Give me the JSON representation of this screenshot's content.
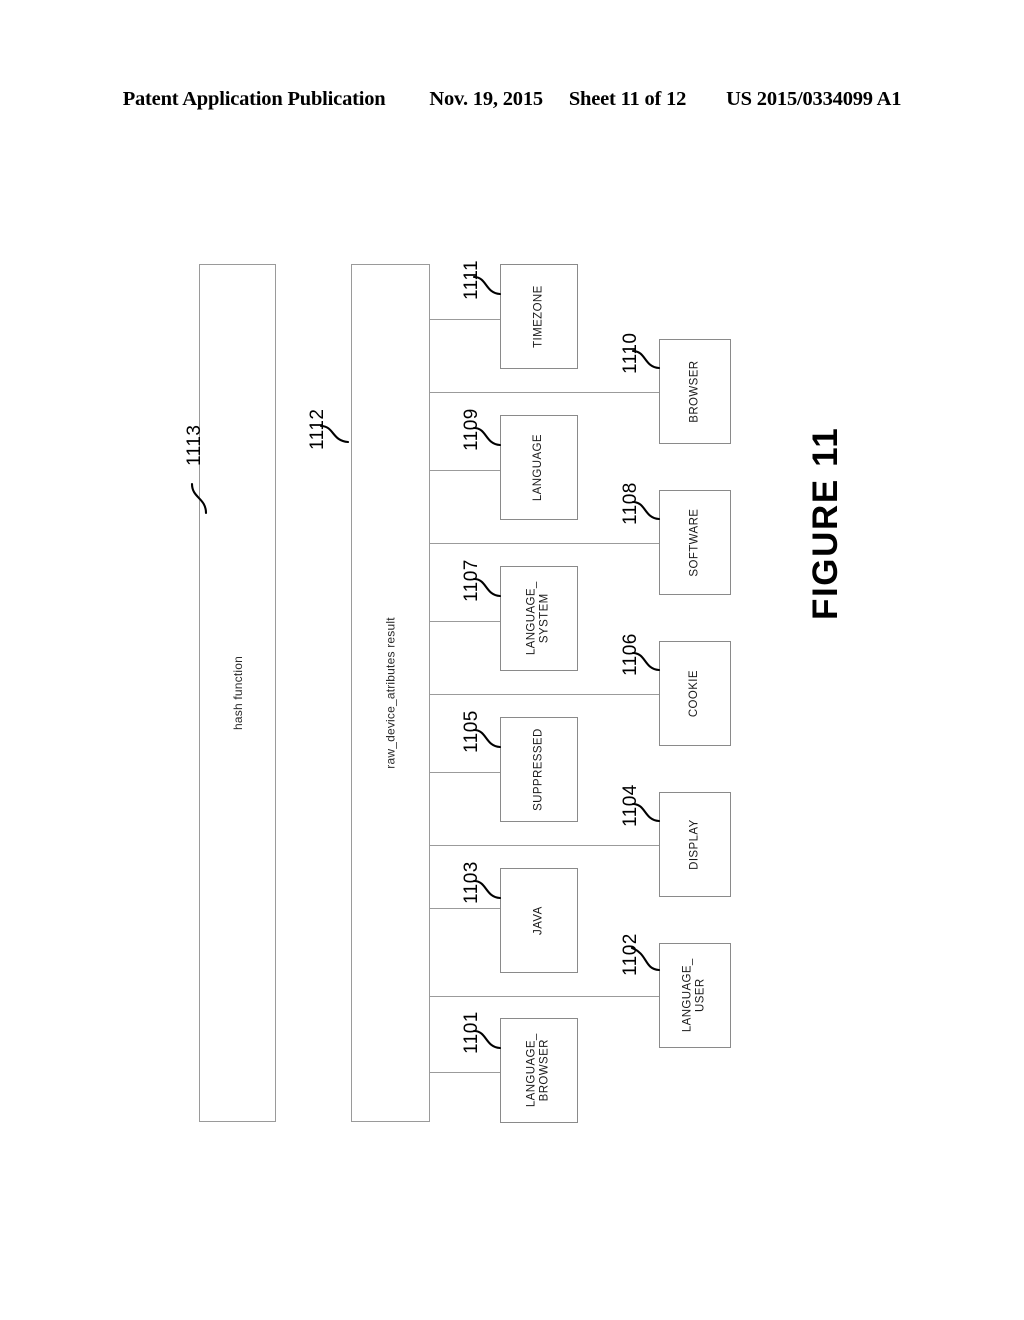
{
  "header": {
    "publication": "Patent Application Publication",
    "date": "Nov. 19, 2015",
    "sheet": "Sheet 11 of 12",
    "pub_number": "US 2015/0334099 A1"
  },
  "figure": {
    "caption": "FIGURE 11"
  },
  "containers": [
    {
      "id": "hash-function",
      "label": "hash function",
      "ref": "1113"
    },
    {
      "id": "raw-device-attributes",
      "label": "raw_device_atributes result",
      "ref": "1112"
    }
  ],
  "attribute_blocks": [
    {
      "id": "timezone",
      "label": "TIMEZONE",
      "ref": "1111",
      "column": 1
    },
    {
      "id": "browser",
      "label": "BROWSER",
      "ref": "1110",
      "column": 2
    },
    {
      "id": "language",
      "label": "LANGUAGE",
      "ref": "1109",
      "column": 1
    },
    {
      "id": "software",
      "label": "SOFTWARE",
      "ref": "1108",
      "column": 2
    },
    {
      "id": "language-system",
      "label": "LANGUAGE_\nSYSTEM",
      "ref": "1107",
      "column": 1
    },
    {
      "id": "cookie",
      "label": "COOKIE",
      "ref": "1106",
      "column": 2
    },
    {
      "id": "suppressed",
      "label": "SUPPRESSED",
      "ref": "1105",
      "column": 1
    },
    {
      "id": "display",
      "label": "DISPLAY",
      "ref": "1104",
      "column": 2
    },
    {
      "id": "java",
      "label": "JAVA",
      "ref": "1103",
      "column": 1
    },
    {
      "id": "language-user",
      "label": "LANGUAGE_\nUSER",
      "ref": "1102",
      "column": 2
    },
    {
      "id": "language-browser",
      "label": "LANGUAGE_\nBROWSER",
      "ref": "1101",
      "column": 1
    }
  ],
  "colors": {
    "line": "#9b9b9b",
    "box_border": "#8a8a8a",
    "text": "#000000",
    "background": "#ffffff"
  }
}
